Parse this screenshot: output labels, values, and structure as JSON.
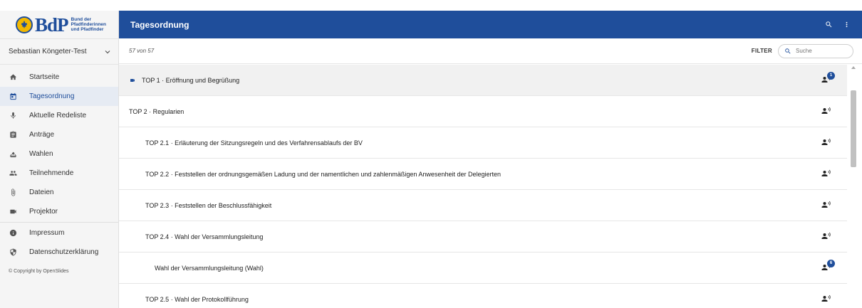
{
  "logo": {
    "wordmark": "BdP",
    "org_line1": "Bund der",
    "org_line2": "Pfadfinderinnen",
    "org_line3": "und Pfadfinder"
  },
  "user": {
    "name": "Sebastian Köngeter-Test"
  },
  "nav": {
    "items": [
      {
        "label": "Startseite",
        "icon": "home-icon"
      },
      {
        "label": "Tagesordnung",
        "icon": "calendar-icon",
        "active": true
      },
      {
        "label": "Aktuelle Redeliste",
        "icon": "mic-icon"
      },
      {
        "label": "Anträge",
        "icon": "clipboard-icon"
      },
      {
        "label": "Wahlen",
        "icon": "ballot-icon"
      },
      {
        "label": "Teilnehmende",
        "icon": "people-icon"
      },
      {
        "label": "Dateien",
        "icon": "paperclip-icon"
      },
      {
        "label": "Projektor",
        "icon": "videocam-icon"
      }
    ],
    "footer_items": [
      {
        "label": "Impressum",
        "icon": "info-icon"
      },
      {
        "label": "Datenschutzerklärung",
        "icon": "shield-icon"
      }
    ],
    "copyright": "© Copyright by OpenSlides"
  },
  "header": {
    "title": "Tagesordnung"
  },
  "toolbar": {
    "count": "57 von 57",
    "filter_label": "FILTER",
    "search_placeholder": "Suche"
  },
  "agenda": [
    {
      "title": "TOP 1 · Eröffnung und Begrüßung",
      "level": 0,
      "projected": true,
      "speakers": "1"
    },
    {
      "title": "TOP 2 · Regularien",
      "level": 0,
      "projected": false,
      "speakers": ""
    },
    {
      "title": "TOP 2.1 · Erläuterung der Sitzungsregeln und des Verfahrensablaufs der BV",
      "level": 1,
      "projected": false,
      "speakers": ""
    },
    {
      "title": "TOP 2.2 · Feststellen der ordnungsgemäßen Ladung und der namentlichen und zahlenmäßigen Anwesenheit der Delegierten",
      "level": 1,
      "projected": false,
      "speakers": ""
    },
    {
      "title": "TOP 2.3 · Feststellen der Beschlussfähigkeit",
      "level": 1,
      "projected": false,
      "speakers": ""
    },
    {
      "title": "TOP 2.4 · Wahl der Versammlungsleitung",
      "level": 1,
      "projected": false,
      "speakers": ""
    },
    {
      "title": "Wahl der Versammlungsleitung (Wahl)",
      "level": 2,
      "projected": false,
      "speakers": "6"
    },
    {
      "title": "TOP 2.5 · Wahl der Protokollführung",
      "level": 1,
      "projected": false,
      "speakers": ""
    }
  ],
  "colors": {
    "primary": "#1f4e9b",
    "sidebar_bg": "#f5f5f5",
    "active_bg": "#e6ebf3"
  }
}
